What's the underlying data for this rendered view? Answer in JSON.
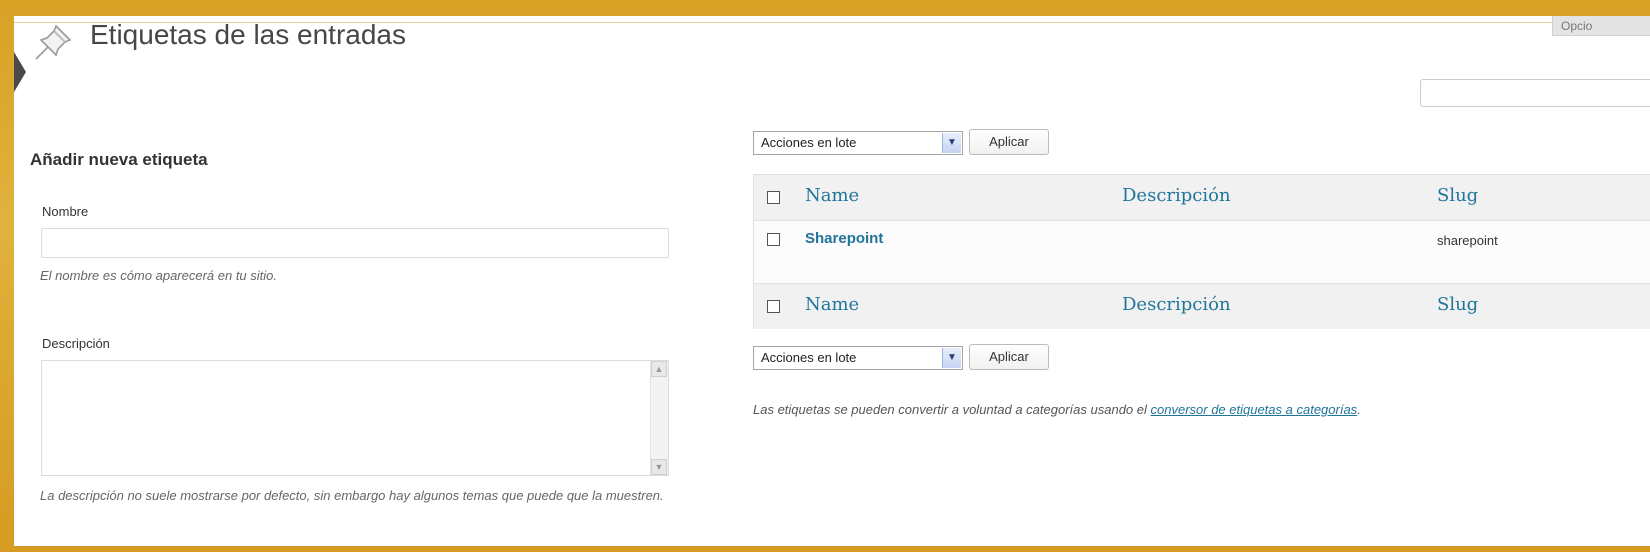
{
  "header": {
    "title": "Etiquetas de las entradas",
    "screen_options_label": "Opcio",
    "icon": "pin-icon"
  },
  "search": {
    "value": ""
  },
  "add_form": {
    "heading": "Añadir nueva etiqueta",
    "name_label": "Nombre",
    "name_value": "",
    "name_hint": "El nombre es cómo aparecerá en tu sitio.",
    "description_label": "Descripción",
    "description_value": "",
    "description_hint": "La descripción no suele mostrarse por defecto, sin embargo hay algunos temas que puede que la muestren."
  },
  "bulk_actions": {
    "top_selected": "Acciones en lote",
    "bottom_selected": "Acciones en lote",
    "apply_label": "Aplicar"
  },
  "table": {
    "columns": [
      "Name",
      "Descripción",
      "Slug"
    ],
    "rows": [
      {
        "name": "Sharepoint",
        "description": "",
        "slug": "sharepoint"
      }
    ]
  },
  "footnote": {
    "text": "Las etiquetas se pueden convertir a voluntad a categorías usando el ",
    "link": "conversor de etiquetas a categorías",
    "end": "."
  },
  "colors": {
    "frame": "#d9a42a",
    "link": "#21759b",
    "header_bg": "#f1f1f1"
  }
}
